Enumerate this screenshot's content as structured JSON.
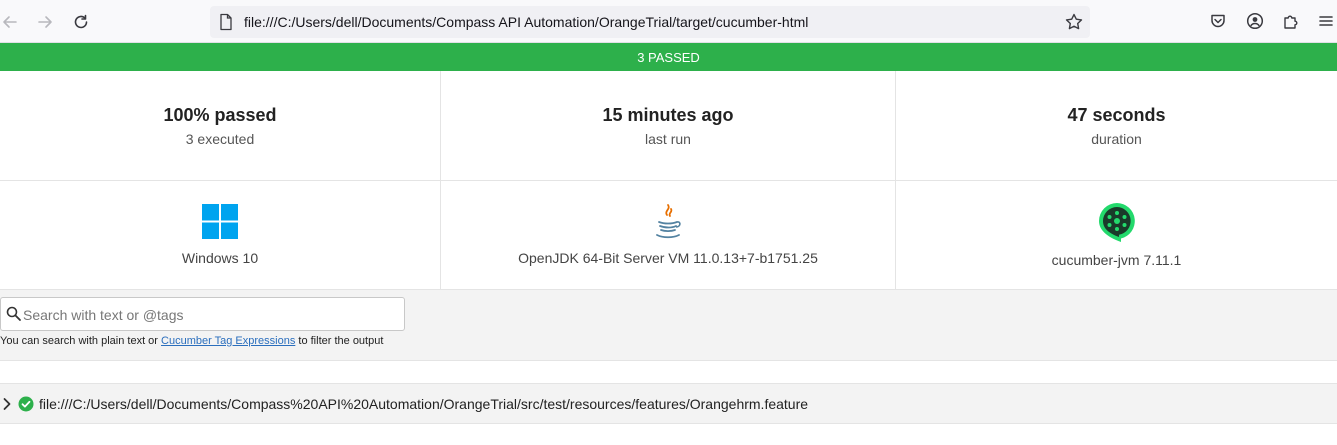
{
  "browser": {
    "url": "file:///C:/Users/dell/Documents/Compass API Automation/OrangeTrial/target/cucumber-html",
    "icons": {
      "back": "arrow-left-icon",
      "forward": "arrow-right-icon",
      "reload": "reload-icon",
      "file": "file-icon",
      "bookmark": "star-icon",
      "pocket": "pocket-icon",
      "account": "account-icon",
      "extensions": "puzzle-icon",
      "menu": "hamburger-menu-icon"
    }
  },
  "banner": {
    "text": "3 PASSED",
    "color": "#2db04b"
  },
  "stats": [
    {
      "value": "100% passed",
      "label": "3 executed"
    },
    {
      "value": "15 minutes ago",
      "label": "last run"
    },
    {
      "value": "47 seconds",
      "label": "duration"
    }
  ],
  "environment": [
    {
      "icon": "windows-logo-icon",
      "label": "Windows 10"
    },
    {
      "icon": "java-logo-icon",
      "label": "OpenJDK 64-Bit Server VM 11.0.13+7-b1751.25"
    },
    {
      "icon": "cucumber-logo-icon",
      "label": "cucumber-jvm 7.11.1"
    }
  ],
  "search": {
    "placeholder": "Search with text or @tags",
    "help_prefix": "You can search with plain text or ",
    "help_link": "Cucumber Tag Expressions",
    "help_suffix": " to filter the output"
  },
  "features": [
    {
      "status": "passed",
      "path": "file:///C:/Users/dell/Documents/Compass%20API%20Automation/OrangeTrial/src/test/resources/features/Orangehrm.feature"
    }
  ]
}
